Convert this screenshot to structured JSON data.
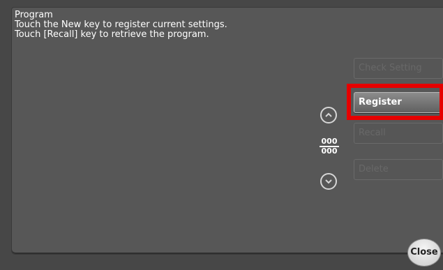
{
  "message": {
    "title": "Program",
    "line1": "Touch the New key to register current settings.",
    "line2": "Touch [Recall] key to retrieve the program."
  },
  "buttons": {
    "check_setting": "Check Setting",
    "register": "Register",
    "recall": "Recall",
    "delete": "Delete",
    "close": "Close"
  },
  "counter": {
    "current": "000",
    "total": "000"
  },
  "colors": {
    "highlight": "#e50000",
    "background": "#575757"
  },
  "icons": {
    "scroll_up": "chevron-up-circle-icon",
    "scroll_down": "chevron-down-circle-icon"
  }
}
